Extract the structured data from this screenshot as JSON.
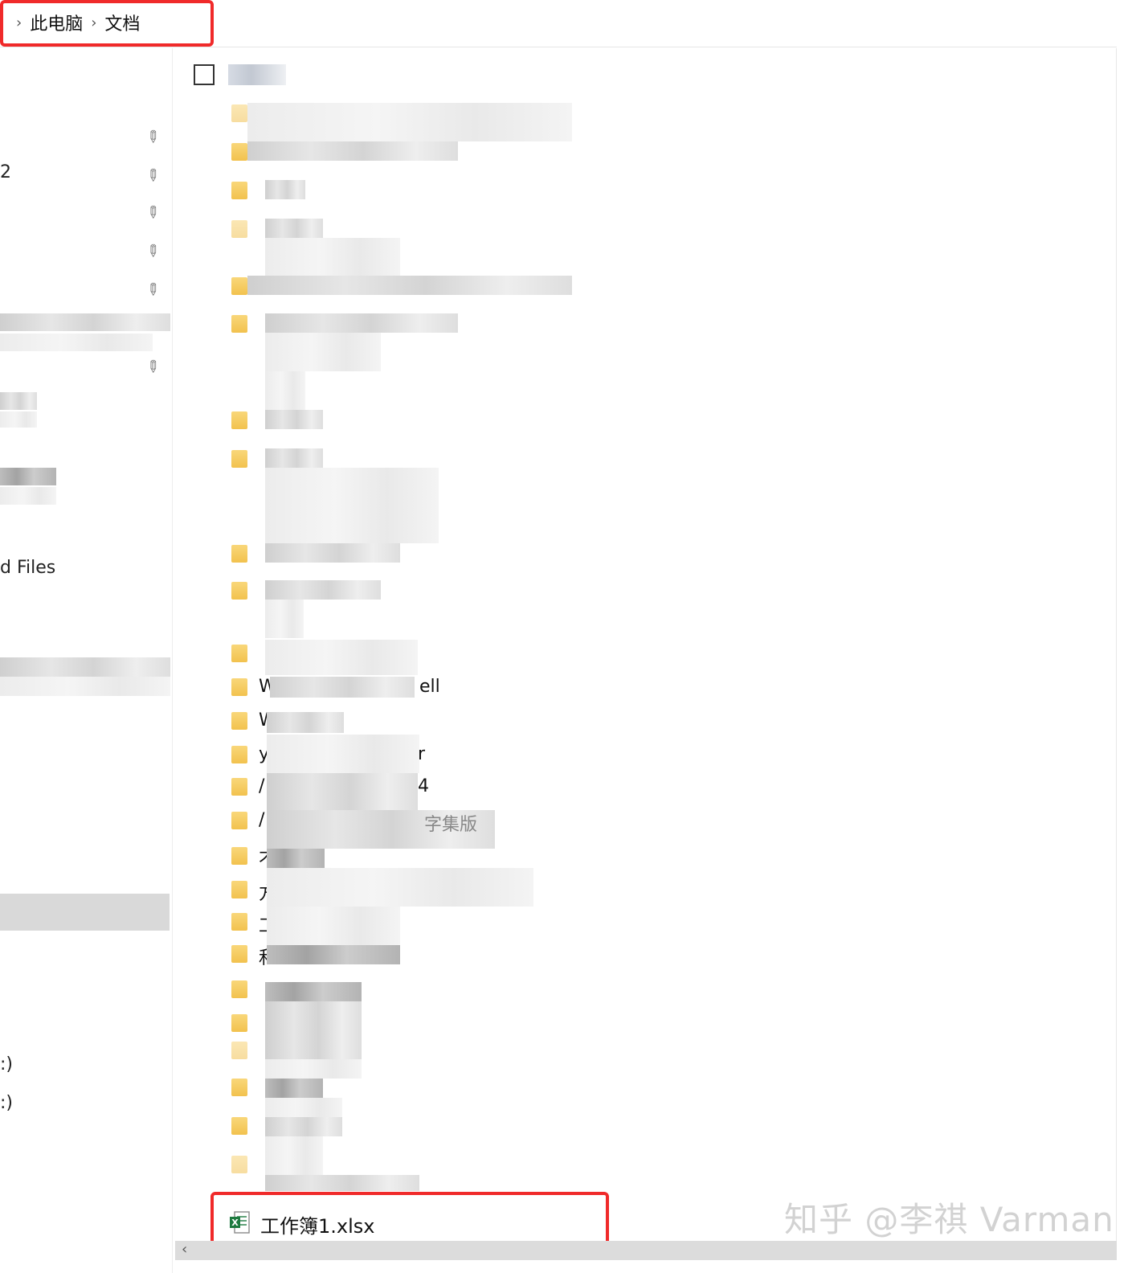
{
  "breadcrumb": {
    "items": [
      "此电脑",
      "文档"
    ]
  },
  "nav": {
    "partial_labels": {
      "item_2": "2",
      "recent_files": "d Files",
      "drive_c": ":)",
      "drive_d": ":)"
    }
  },
  "file_list": {
    "visible_fragments": [
      {
        "prefix": "W",
        "suffix": "ell"
      },
      {
        "prefix": "W",
        "suffix": ""
      },
      {
        "prefix": "y",
        "suffix": "r"
      },
      {
        "prefix": "/",
        "suffix": "4"
      },
      {
        "prefix": "/",
        "suffix": "字集版"
      },
      {
        "prefix": "不",
        "suffix": ""
      },
      {
        "prefix": "方",
        "suffix": ""
      },
      {
        "prefix": "工",
        "suffix": ""
      },
      {
        "prefix": "和",
        "suffix": ""
      }
    ],
    "highlighted_file": {
      "name": "工作簿1.xlsx",
      "icon": "excel-file-icon"
    }
  },
  "watermark": "知乎 @李祺 Varman",
  "colors": {
    "highlight_border": "#f02a2a",
    "folder_icon": "#f2c24e",
    "excel_green": "#1d7a3f"
  }
}
